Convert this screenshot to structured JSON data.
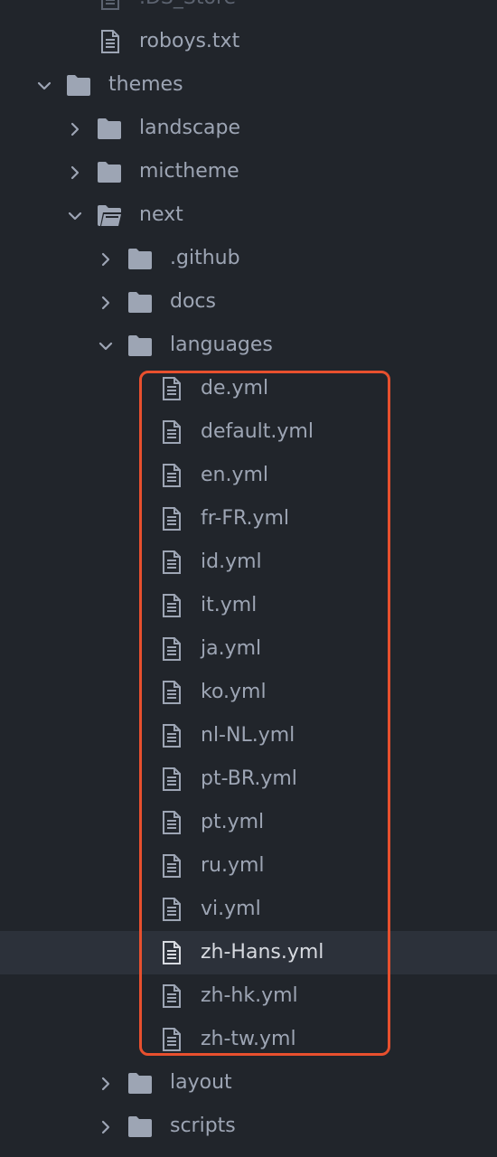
{
  "tree": {
    "items": [
      {
        "label": ".DS_Store",
        "type": "file",
        "depth": 2,
        "state": "none",
        "dim": true
      },
      {
        "label": "roboys.txt",
        "type": "file",
        "depth": 2,
        "state": "none"
      },
      {
        "label": "themes",
        "type": "folder",
        "depth": 1,
        "state": "expanded"
      },
      {
        "label": "landscape",
        "type": "folder",
        "depth": 2,
        "state": "collapsed"
      },
      {
        "label": "mictheme",
        "type": "folder",
        "depth": 2,
        "state": "collapsed"
      },
      {
        "label": "next",
        "type": "folder-open",
        "depth": 2,
        "state": "expanded"
      },
      {
        "label": ".github",
        "type": "folder",
        "depth": 3,
        "state": "collapsed"
      },
      {
        "label": "docs",
        "type": "folder",
        "depth": 3,
        "state": "collapsed"
      },
      {
        "label": "languages",
        "type": "folder",
        "depth": 3,
        "state": "expanded"
      },
      {
        "label": "de.yml",
        "type": "file",
        "depth": 4,
        "state": "none"
      },
      {
        "label": "default.yml",
        "type": "file",
        "depth": 4,
        "state": "none"
      },
      {
        "label": "en.yml",
        "type": "file",
        "depth": 4,
        "state": "none"
      },
      {
        "label": "fr-FR.yml",
        "type": "file",
        "depth": 4,
        "state": "none"
      },
      {
        "label": "id.yml",
        "type": "file",
        "depth": 4,
        "state": "none"
      },
      {
        "label": "it.yml",
        "type": "file",
        "depth": 4,
        "state": "none"
      },
      {
        "label": "ja.yml",
        "type": "file",
        "depth": 4,
        "state": "none"
      },
      {
        "label": "ko.yml",
        "type": "file",
        "depth": 4,
        "state": "none"
      },
      {
        "label": "nl-NL.yml",
        "type": "file",
        "depth": 4,
        "state": "none"
      },
      {
        "label": "pt-BR.yml",
        "type": "file",
        "depth": 4,
        "state": "none"
      },
      {
        "label": "pt.yml",
        "type": "file",
        "depth": 4,
        "state": "none"
      },
      {
        "label": "ru.yml",
        "type": "file",
        "depth": 4,
        "state": "none"
      },
      {
        "label": "vi.yml",
        "type": "file",
        "depth": 4,
        "state": "none"
      },
      {
        "label": "zh-Hans.yml",
        "type": "file",
        "depth": 4,
        "state": "none",
        "selected": true
      },
      {
        "label": "zh-hk.yml",
        "type": "file",
        "depth": 4,
        "state": "none"
      },
      {
        "label": "zh-tw.yml",
        "type": "file",
        "depth": 4,
        "state": "none"
      },
      {
        "label": "layout",
        "type": "folder",
        "depth": 3,
        "state": "collapsed"
      },
      {
        "label": "scripts",
        "type": "folder",
        "depth": 3,
        "state": "collapsed"
      }
    ]
  },
  "colors": {
    "background": "#21252b",
    "selected_row": "#2c313a",
    "text": "#9da5b4",
    "icon": "#9da5b4",
    "highlight_border": "#e8502e"
  }
}
